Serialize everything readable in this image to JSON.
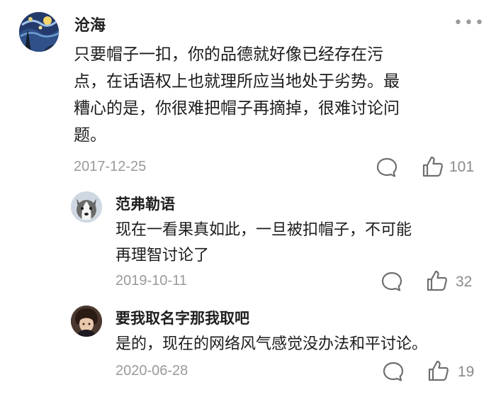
{
  "comments": [
    {
      "username": "沧海",
      "text_lines": [
        "只要帽子一扣，你的品德就好像已经存在污",
        "点，在话语权上也就理所应当地处于劣势。最",
        "糟心的是，你很难把帽子再摘掉，很难讨论问",
        "题。"
      ],
      "date": "2017-12-25",
      "likes": "101",
      "icons": {
        "avatar": "starry-night-avatar",
        "reply": "comment-bubble-icon",
        "like": "thumbs-up-icon",
        "more": "more-dots-icon"
      }
    },
    {
      "username": "范弗勒语",
      "text_lines": [
        "现在一看果真如此，一旦被扣帽子，不可能",
        "再理智讨论了"
      ],
      "date": "2019-10-11",
      "likes": "32",
      "icons": {
        "avatar": "husky-dog-avatar",
        "reply": "comment-bubble-icon",
        "like": "thumbs-up-icon"
      }
    },
    {
      "username": "要我取名字那我取吧",
      "text_lines": [
        "是的，现在的网络风气感觉没办法和平讨论。"
      ],
      "date": "2020-06-28",
      "likes": "19",
      "icons": {
        "avatar": "anime-character-avatar",
        "reply": "comment-bubble-icon",
        "like": "thumbs-up-icon"
      }
    }
  ],
  "colors": {
    "text": "#1c1c1c",
    "meta": "#9a9a9a",
    "icon": "#7a7a7a"
  }
}
